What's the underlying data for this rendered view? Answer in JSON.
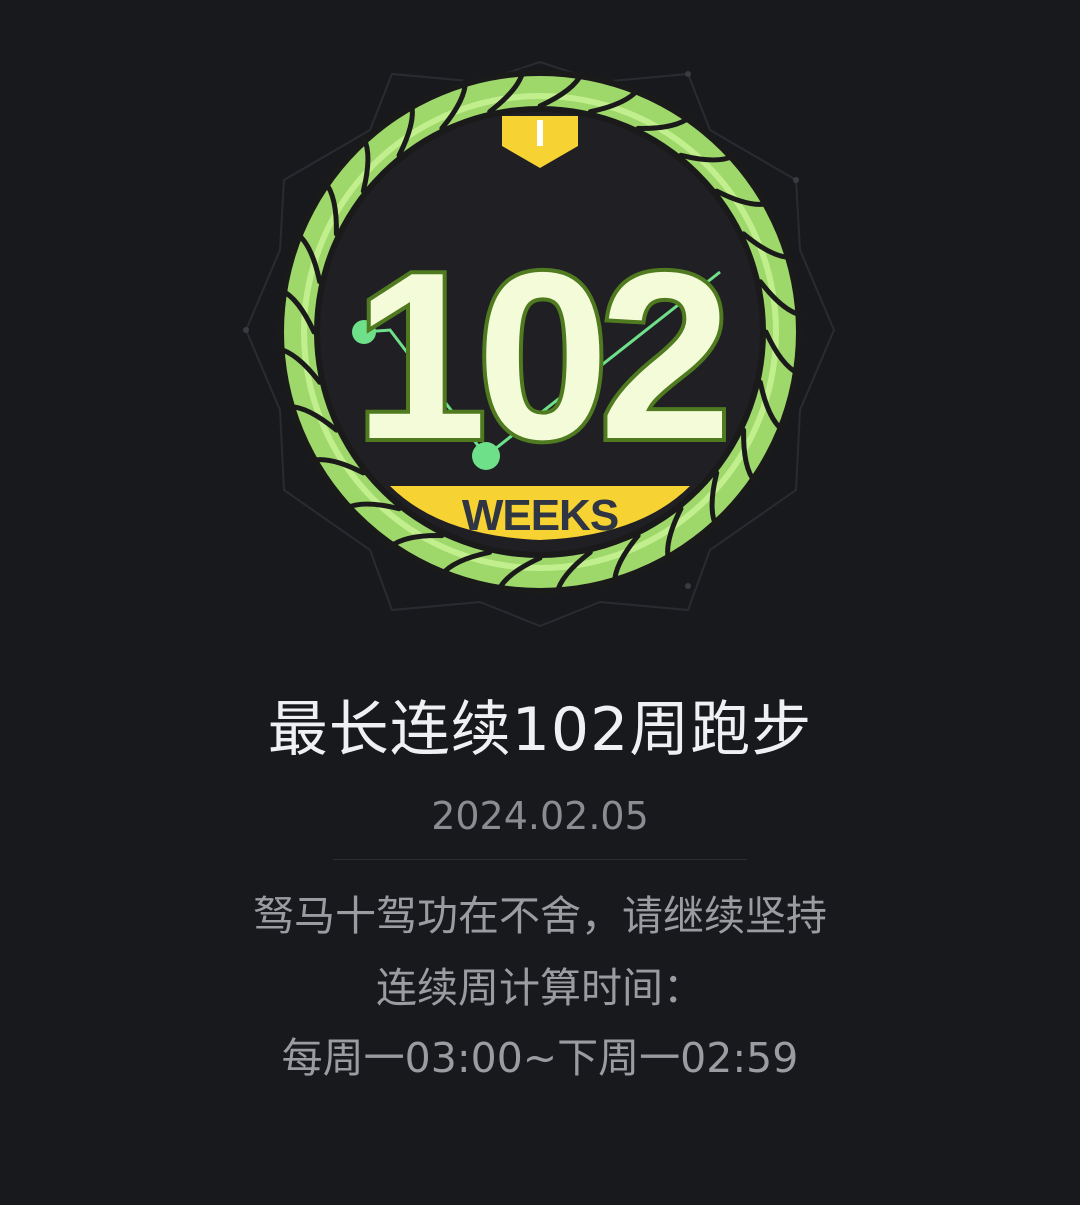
{
  "badge": {
    "number": "102",
    "unit": "WEEKS",
    "colors": {
      "rope_light": "#9fd86a",
      "rope_dark": "#1a1a1a",
      "number_fill": "#f4fbd9",
      "number_stroke": "#4f7a1f",
      "ribbon": "#f6d233",
      "ribbon_text": "#2f3542",
      "inner": "#1f1f24",
      "sparkline": "#6fe08a"
    }
  },
  "title": "最长连续102周跑步",
  "date": "2024.02.05",
  "description": {
    "line1": "驽马十驾功在不舍，请继续坚持",
    "line2": "连续周计算时间：",
    "line3": "每周一03:00~下周一02:59"
  }
}
